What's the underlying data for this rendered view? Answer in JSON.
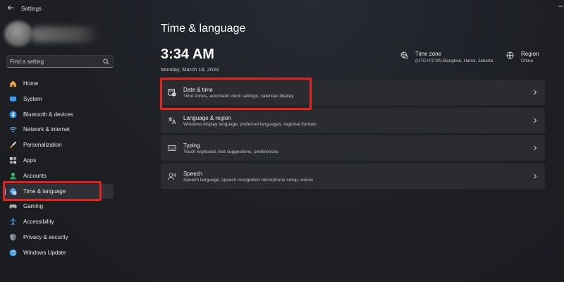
{
  "window": {
    "title": "Settings"
  },
  "search": {
    "placeholder": "Find a setting"
  },
  "sidebar": {
    "items": [
      {
        "label": "Home",
        "icon": "home-icon"
      },
      {
        "label": "System",
        "icon": "monitor-icon"
      },
      {
        "label": "Bluetooth & devices",
        "icon": "bluetooth-icon"
      },
      {
        "label": "Network & internet",
        "icon": "wifi-icon"
      },
      {
        "label": "Personalization",
        "icon": "brush-icon"
      },
      {
        "label": "Apps",
        "icon": "apps-grid-icon"
      },
      {
        "label": "Accounts",
        "icon": "person-icon"
      },
      {
        "label": "Time & language",
        "icon": "globe-clock-icon",
        "selected": true
      },
      {
        "label": "Gaming",
        "icon": "gamepad-icon"
      },
      {
        "label": "Accessibility",
        "icon": "accessibility-icon"
      },
      {
        "label": "Privacy & security",
        "icon": "shield-icon"
      },
      {
        "label": "Windows Update",
        "icon": "update-icon"
      }
    ]
  },
  "main": {
    "title": "Time & language",
    "time": "3:34 AM",
    "date": "Monday, March 18, 2024",
    "time_zone": {
      "title": "Time zone",
      "value": "(UTC+07:00) Bangkok, Hanoi, Jakarta",
      "icon": "globe-clock-icon"
    },
    "region": {
      "title": "Region",
      "value": "China",
      "icon": "globe-icon"
    },
    "cards": [
      {
        "title": "Date & time",
        "desc": "Time zones, automatic clock settings, calendar display",
        "icon": "calendar-clock-icon"
      },
      {
        "title": "Language & region",
        "desc": "Windows display language, preferred languages, regional formats",
        "icon": "language-icon"
      },
      {
        "title": "Typing",
        "desc": "Touch keyboard, text suggestions, preferences",
        "icon": "keyboard-icon"
      },
      {
        "title": "Speech",
        "desc": "Speech language, speech recognition microphone setup, voices",
        "icon": "speech-icon"
      }
    ]
  },
  "colors": {
    "accent": "#4cc2ff",
    "highlight": "#e5231f",
    "background": "#1f2024",
    "card": "#2b2c30"
  }
}
